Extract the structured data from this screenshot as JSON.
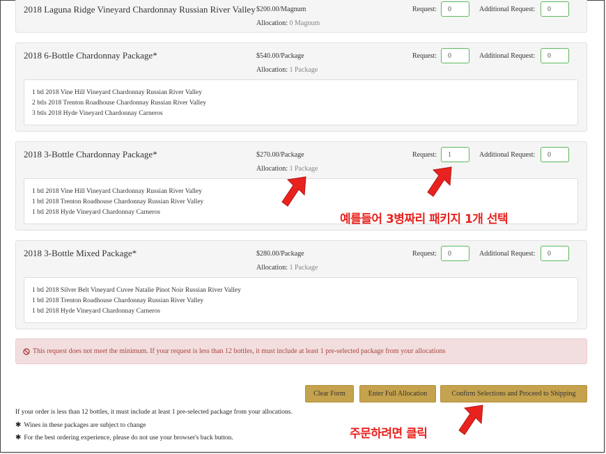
{
  "products": [
    {
      "name": "2018 Laguna Ridge Vineyard Chardonnay Russian River Valley",
      "price": "$200.00",
      "unit": "/Magnum",
      "allocation_label": "Allocation:",
      "allocation_value": "0 Magnum",
      "request_label": "Request:",
      "request_value": "0",
      "additional_label": "Additional Request:",
      "additional_value": "0",
      "contents": []
    },
    {
      "name": "2018 6-Bottle Chardonnay Package*",
      "price": "$540.00",
      "unit": "/Package",
      "allocation_label": "Allocation:",
      "allocation_value": "1 Package",
      "request_label": "Request:",
      "request_value": "0",
      "additional_label": "Additional Request:",
      "additional_value": "0",
      "contents": [
        "1 btl 2018 Vine Hill Vineyard Chardonnay Russian River Valley",
        "2 btls 2018 Trenton Roadhouse Chardonnay Russian River Valley",
        "3 btls 2018 Hyde Vineyard Chardonnay Carneros"
      ]
    },
    {
      "name": "2018 3-Bottle Chardonnay Package*",
      "price": "$270.00",
      "unit": "/Package",
      "allocation_label": "Allocation:",
      "allocation_value": "1 Package",
      "request_label": "Request:",
      "request_value": "1",
      "additional_label": "Additional Request:",
      "additional_value": "0",
      "contents": [
        "1 btl 2018 Vine Hill Vineyard Chardonnay Russian River Valley",
        "1 btl 2018 Trenton Roadhouse Chardonnay Russian River Valley",
        "1 btl 2018 Hyde Vineyard Chardonnay Carneros"
      ]
    },
    {
      "name": "2018 3-Bottle Mixed Package*",
      "price": "$280.00",
      "unit": "/Package",
      "allocation_label": "Allocation:",
      "allocation_value": "1 Package",
      "request_label": "Request:",
      "request_value": "0",
      "additional_label": "Additional Request:",
      "additional_value": "0",
      "contents": [
        "1 btl 2018 Silver Belt Vineyard Cuvee Natalie Pinot Noir Russian River Valley",
        "1 btl 2018 Trenton Roadhouse Chardonnay Russian River Valley",
        "1 btl 2018 Hyde Vineyard Chardonnay Carneros"
      ]
    }
  ],
  "alert": {
    "icon": "ban-icon",
    "text": "This request does not meet the minimum. If your request is less than 12 bottles, it must include at least 1 pre-selected package from your allocations"
  },
  "buttons": {
    "clear": "Clear Form",
    "full": "Enter Full Allocation",
    "confirm": "Confirm Selections and Proceed to Shipping"
  },
  "notes": {
    "line1": "If your order is less than 12 bottles, it must include at least 1 pre-selected package from your allocations.",
    "bullet": "✱",
    "line2": "Wines in these packages are subject to change",
    "line3": "For the best ordering experience, please do not use your browser's back button."
  },
  "annotations": {
    "select_package": "예를들어 3병짜리 패키지 1개 선택",
    "click_to_order": "주문하려면 클릭"
  },
  "colors": {
    "button": "#c5a24d",
    "input_border": "#5cb85c",
    "alert_bg": "#f2dede",
    "alert_text": "#a94442",
    "annotation": "#e8231f"
  }
}
